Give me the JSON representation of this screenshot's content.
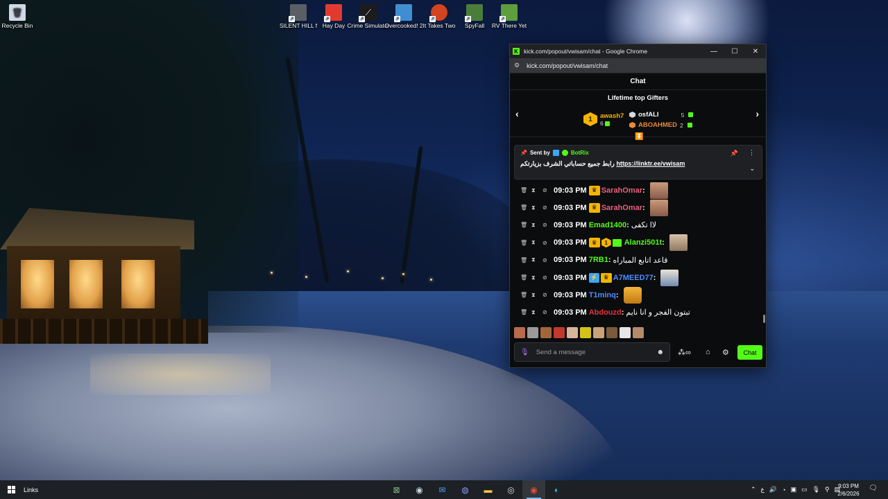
{
  "desktop": {
    "icons": [
      {
        "label": "Recycle Bin",
        "icon": "recycle-bin-icon",
        "color": "#cfd8e3"
      },
      {
        "label": "SILENT HILL f",
        "icon": "silent-hill-f-icon",
        "color": "#5a5f66"
      },
      {
        "label": "Hay Day",
        "icon": "hay-day-icon",
        "color": "#e23b2e"
      },
      {
        "label": "Crime Simulator",
        "icon": "crime-simulator-icon",
        "color": "#1c1c1c"
      },
      {
        "label": "Overcooked! 2",
        "icon": "overcooked-2-icon",
        "color": "#3f8fd0"
      },
      {
        "label": "It Takes Two",
        "icon": "it-takes-two-icon",
        "color": "#d2431f"
      },
      {
        "label": "SpyFall",
        "icon": "spyfall-icon",
        "color": "#4b7d3a"
      },
      {
        "label": "RV There Yet",
        "icon": "rv-there-yet-icon",
        "color": "#5e9e3c"
      }
    ]
  },
  "browser": {
    "window_title": "kick.com/popout/vwisam/chat - Google Chrome",
    "url": "kick.com/popout/vwisam/chat",
    "minimize": "—",
    "maximize": "☐",
    "close": "✕"
  },
  "chat": {
    "header": "Chat",
    "gifters": {
      "title": "Lifetime top Gifters",
      "prev": "‹",
      "next": "›",
      "first": {
        "rank": "1",
        "name": "awash7",
        "count": "6",
        "color": "#f5b400"
      },
      "second": {
        "name": "osfALI",
        "count": "5",
        "color": "#ffffff"
      },
      "third": {
        "name": "ABOAHMED",
        "count": "2",
        "color": "#e8893a"
      }
    },
    "pinned": {
      "sent_by": "Sent by",
      "bot_name": "BotRix",
      "message": "رابط جميع حساباتي الشرف بزيارتكم",
      "link": "https://linktr.ee/vwisam"
    },
    "messages": [
      {
        "time": "09:03 PM",
        "badges": [
          "crown"
        ],
        "user": "SarahOmar",
        "user_color": "#e8607a",
        "text": "",
        "emote": "profile-photo-emote"
      },
      {
        "time": "09:03 PM",
        "badges": [
          "crown"
        ],
        "user": "SarahOmar",
        "user_color": "#e8607a",
        "text": "",
        "emote": "profile-photo-emote"
      },
      {
        "time": "09:03 PM",
        "badges": [],
        "user": "Emad1400",
        "user_color": "#53fc18",
        "text": "لاا تكفى",
        "emote": ""
      },
      {
        "time": "09:03 PM",
        "badges": [
          "crown",
          "gift1",
          "gift"
        ],
        "user": "Alanzi501t",
        "user_color": "#53fc18",
        "text": "",
        "emote": "face-photo-emote"
      },
      {
        "time": "09:03 PM",
        "badges": [],
        "user": "7RB1",
        "user_color": "#53fc18",
        "text": "قاعد اتابع المباراه",
        "emote": ""
      },
      {
        "time": "09:03 PM",
        "badges": [
          "bot",
          "crown"
        ],
        "user": "A7MEED77",
        "user_color": "#4c8dff",
        "text": "",
        "emote": "man-photo-emote"
      },
      {
        "time": "09:03 PM",
        "badges": [],
        "user": "T1minq",
        "user_color": "#4c8dff",
        "text": "",
        "emote": "beer-mug-emote"
      },
      {
        "time": "09:03 PM",
        "badges": [],
        "user": "Abdouzd",
        "user_color": "#e8303a",
        "text": "تبتون الفجر و انا نايم",
        "emote": ""
      }
    ],
    "input_placeholder": "Send a message",
    "send_label": "Chat"
  },
  "taskbar": {
    "links_label": "Links",
    "apps": [
      "xbox-icon",
      "steam-icon",
      "mail-icon",
      "discord-icon",
      "file-explorer-icon",
      "obs-icon",
      "chrome-icon",
      "edge-icon"
    ],
    "active_app": "chrome-icon",
    "clock_time": "9:03 PM",
    "clock_date": "2/6/2026",
    "language": "ع"
  }
}
